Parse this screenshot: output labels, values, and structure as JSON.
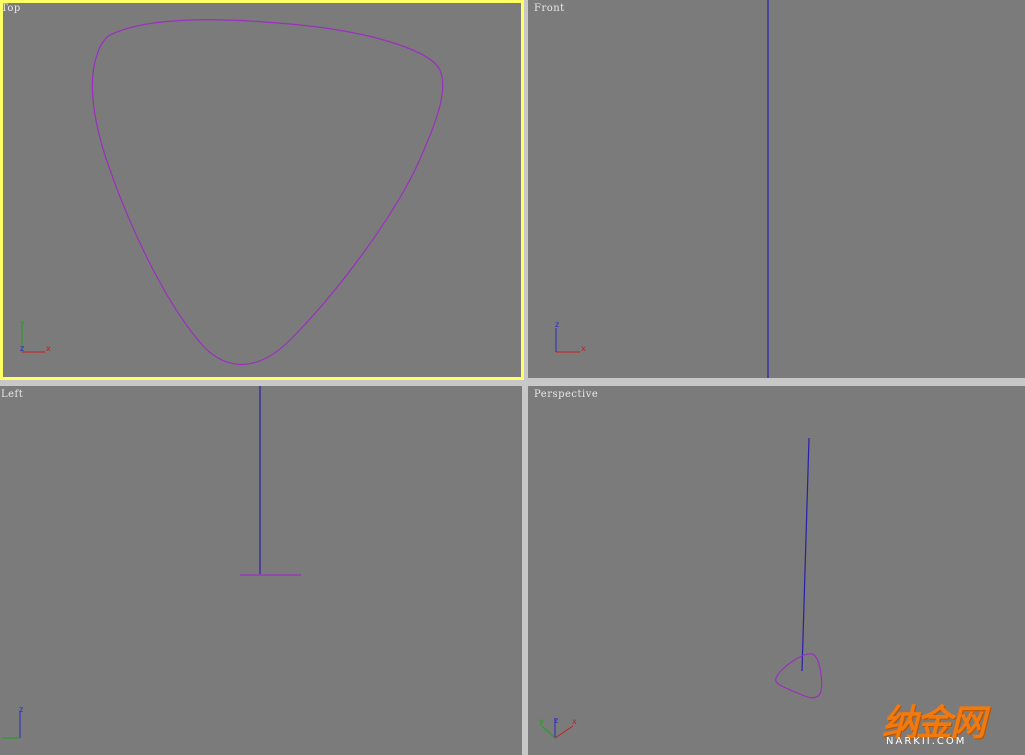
{
  "viewports": {
    "top": {
      "label": "Top",
      "active": true
    },
    "front": {
      "label": "Front"
    },
    "left": {
      "label": "Left"
    },
    "perspective": {
      "label": "Perspective"
    }
  },
  "axes": {
    "x": "x",
    "y": "y",
    "z": "z"
  },
  "colors": {
    "viewport_bg": "#7b7b7b",
    "active_border": "#ffff66",
    "shape": "#9b2fbf",
    "line": "#2a1fa8",
    "axis_x": "#c81e1e",
    "axis_y": "#1ea01e",
    "axis_z": "#2a2ac0"
  },
  "watermark": {
    "cn": "纳金网",
    "en": "NARKII.COM"
  }
}
